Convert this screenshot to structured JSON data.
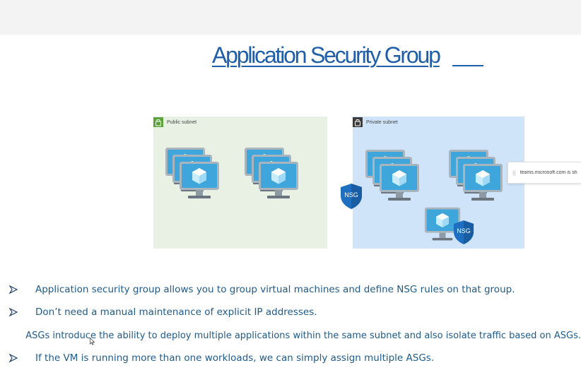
{
  "slide": {
    "title": "Application Security  Group",
    "public_subnet_label": "Public subnet",
    "private_subnet_label": "Private subnet",
    "nsg_label": "NSG",
    "bullets": [
      "Application security group allows you to group virtual machines and define NSG rules on that group.",
      "Don’t need a manual maintenance of explicit IP addresses.",
      "ASGs introduce the ability to deploy multiple applications within the same subnet and also isolate traffic based on ASGs.",
      "If the VM is running more than one workloads, we can simply assign multiple ASGs."
    ]
  },
  "toast": {
    "text": "teams.microsoft.com is sh"
  },
  "icons": {
    "lock": "lock-icon",
    "vm": "virtual-machine-icon",
    "shield": "nsg-shield-icon",
    "bullet": "arrow-bullet-icon",
    "cursor": "mouse-cursor-icon"
  },
  "colors": {
    "title": "#1f5ea8",
    "public_subnet_bg": "#e8f1e4",
    "private_subnet_bg": "#cfe4f9",
    "nsg_shield": "#1f6fc0",
    "bullet_text": "#1f5a8a"
  }
}
